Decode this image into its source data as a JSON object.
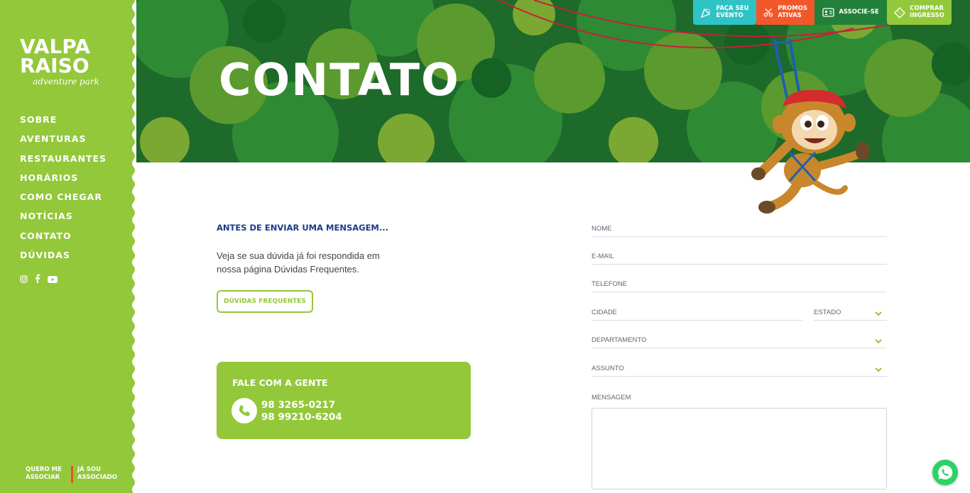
{
  "brand": {
    "logo_line1": "VALPA",
    "logo_line2": "RAISO",
    "logo_sub": "adventure park",
    "accent": "#93c83a",
    "navy": "#1e3b8a"
  },
  "sidebar": {
    "nav": [
      {
        "label": "SOBRE"
      },
      {
        "label": "AVENTURAS"
      },
      {
        "label": "RESTAURANTES"
      },
      {
        "label": "HORÁRIOS"
      },
      {
        "label": "COMO CHEGAR"
      },
      {
        "label": "NOTÍCIAS"
      },
      {
        "label": "CONTATO"
      },
      {
        "label": "DÚVIDAS"
      }
    ],
    "social_icons": [
      "instagram-icon",
      "facebook-icon",
      "youtube-icon"
    ],
    "quero_associar": "QUERO ME\nASSOCIAR",
    "ja_sou": "JÁ SOU\nASSOCIADO"
  },
  "top_actions": {
    "evento": "FAÇA SEU\nEVENTO",
    "promos": "PROMOS\nATIVAS",
    "associe": "ASSOCIE-SE",
    "comprar": "COMPRAR\nINGRESSO"
  },
  "hero": {
    "title": "CONTATO"
  },
  "before": {
    "heading": "ANTES DE ENVIAR UMA MENSAGEM...",
    "text": "Veja se sua dúvida já foi respondida em nossa página Dúvidas Frequentes.",
    "faq_button": "DÚVIDAS FREQUENTES"
  },
  "contact": {
    "title": "FALE COM A GENTE",
    "phone1": "98 3265-0217",
    "phone2": "98 99210-6204"
  },
  "form": {
    "nome": "NOME",
    "email": "E-MAIL",
    "telefone": "TELEFONE",
    "cidade": "CIDADE",
    "estado": "ESTADO",
    "departamento": "DEPARTAMENTO",
    "assunto": "ASSUNTO",
    "mensagem": "MENSAGEM"
  }
}
